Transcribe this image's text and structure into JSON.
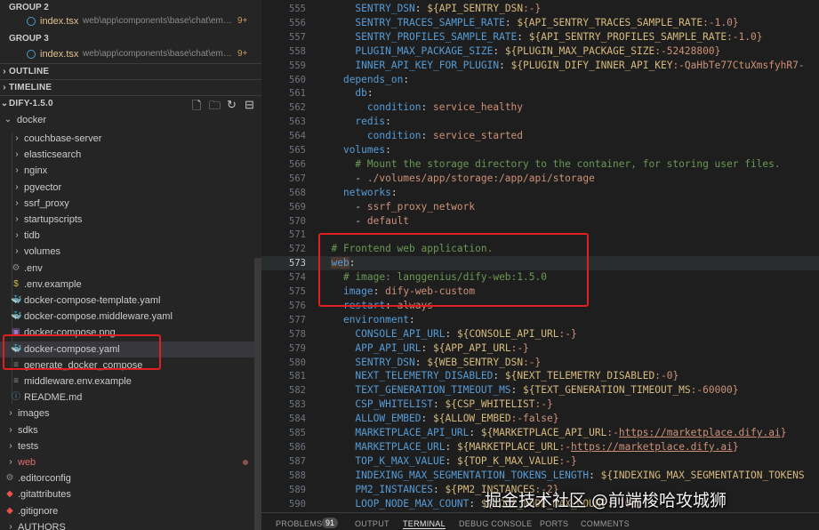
{
  "open_editors": {
    "groups": [
      {
        "label": "GROUP 2",
        "file": "index.tsx",
        "path": "web\\app\\components\\base\\chat\\emb...",
        "badge": "9+"
      },
      {
        "label": "GROUP 3",
        "file": "index.tsx",
        "path": "web\\app\\components\\base\\chat\\emb...",
        "badge": "9+"
      }
    ]
  },
  "sections": {
    "outline": "OUTLINE",
    "timeline": "TIMELINE",
    "project": "DIFY-1.5.0"
  },
  "explorer": {
    "docker_folder": "docker",
    "docker_children": [
      {
        "type": "folder",
        "name": "couchbase-server"
      },
      {
        "type": "folder",
        "name": "elasticsearch"
      },
      {
        "type": "folder",
        "name": "nginx"
      },
      {
        "type": "folder",
        "name": "pgvector"
      },
      {
        "type": "folder",
        "name": "ssrf_proxy"
      },
      {
        "type": "folder",
        "name": "startupscripts"
      },
      {
        "type": "folder",
        "name": "tidb"
      },
      {
        "type": "folder",
        "name": "volumes"
      },
      {
        "type": "file",
        "name": ".env",
        "icon": "gear-icon"
      },
      {
        "type": "file",
        "name": ".env.example",
        "icon": "dollar-icon"
      },
      {
        "type": "file",
        "name": "docker-compose-template.yaml",
        "icon": "docker-icon"
      },
      {
        "type": "file",
        "name": "docker-compose.middleware.yaml",
        "icon": "docker-icon"
      },
      {
        "type": "file",
        "name": "docker-compose.png",
        "icon": "image-icon"
      },
      {
        "type": "file",
        "name": "docker-compose.yaml",
        "icon": "docker-icon"
      },
      {
        "type": "file",
        "name": "generate_docker_compose",
        "icon": "file-icon"
      },
      {
        "type": "file",
        "name": "middleware.env.example",
        "icon": "file-icon"
      },
      {
        "type": "file",
        "name": "README.md",
        "icon": "info-icon"
      }
    ],
    "root_items": [
      {
        "type": "folder",
        "name": "images"
      },
      {
        "type": "folder",
        "name": "sdks"
      },
      {
        "type": "folder",
        "name": "tests"
      },
      {
        "type": "folder",
        "name": "web"
      },
      {
        "type": "file",
        "name": ".editorconfig",
        "icon": "gear-icon"
      },
      {
        "type": "file",
        "name": ".gitattributes",
        "icon": "git-icon"
      },
      {
        "type": "file",
        "name": ".gitignore",
        "icon": "git-icon"
      },
      {
        "type": "folder",
        "name": "AUTHORS"
      }
    ]
  },
  "editor": {
    "active_line": "573",
    "lines": [
      {
        "n": "555",
        "t": "      SENTRY_DSN: ${API_SENTRY_DSN:-}"
      },
      {
        "n": "556",
        "t": "      SENTRY_TRACES_SAMPLE_RATE: ${API_SENTRY_TRACES_SAMPLE_RATE:-1.0}"
      },
      {
        "n": "557",
        "t": "      SENTRY_PROFILES_SAMPLE_RATE: ${API_SENTRY_PROFILES_SAMPLE_RATE:-1.0}"
      },
      {
        "n": "558",
        "t": "      PLUGIN_MAX_PACKAGE_SIZE: ${PLUGIN_MAX_PACKAGE_SIZE:-52428800}"
      },
      {
        "n": "559",
        "t": "      INNER_API_KEY_FOR_PLUGIN: ${PLUGIN_DIFY_INNER_API_KEY:-QaHbTe77CtuXmsfyhR7-"
      },
      {
        "n": "560",
        "t": "    depends_on:"
      },
      {
        "n": "561",
        "t": "      db:"
      },
      {
        "n": "562",
        "t": "        condition: service_healthy"
      },
      {
        "n": "563",
        "t": "      redis:"
      },
      {
        "n": "564",
        "t": "        condition: service_started"
      },
      {
        "n": "565",
        "t": "    volumes:"
      },
      {
        "n": "566",
        "t": "      # Mount the storage directory to the container, for storing user files."
      },
      {
        "n": "567",
        "t": "      - ./volumes/app/storage:/app/api/storage"
      },
      {
        "n": "568",
        "t": "    networks:"
      },
      {
        "n": "569",
        "t": "      - ssrf_proxy_network"
      },
      {
        "n": "570",
        "t": "      - default"
      },
      {
        "n": "571",
        "t": ""
      },
      {
        "n": "572",
        "t": "  # Frontend web application."
      },
      {
        "n": "573",
        "t": "  web:"
      },
      {
        "n": "574",
        "t": "    # image: langgenius/dify-web:1.5.0"
      },
      {
        "n": "575",
        "t": "    image: dify-web-custom"
      },
      {
        "n": "576",
        "t": "    restart: always"
      },
      {
        "n": "577",
        "t": "    environment:"
      },
      {
        "n": "578",
        "t": "      CONSOLE_API_URL: ${CONSOLE_API_URL:-}"
      },
      {
        "n": "579",
        "t": "      APP_API_URL: ${APP_API_URL:-}"
      },
      {
        "n": "580",
        "t": "      SENTRY_DSN: ${WEB_SENTRY_DSN:-}"
      },
      {
        "n": "581",
        "t": "      NEXT_TELEMETRY_DISABLED: ${NEXT_TELEMETRY_DISABLED:-0}"
      },
      {
        "n": "582",
        "t": "      TEXT_GENERATION_TIMEOUT_MS: ${TEXT_GENERATION_TIMEOUT_MS:-60000}"
      },
      {
        "n": "583",
        "t": "      CSP_WHITELIST: ${CSP_WHITELIST:-}"
      },
      {
        "n": "584",
        "t": "      ALLOW_EMBED: ${ALLOW_EMBED:-false}"
      },
      {
        "n": "585",
        "t": "      MARKETPLACE_API_URL: ${MARKETPLACE_API_URL:-https://marketplace.dify.ai}"
      },
      {
        "n": "586",
        "t": "      MARKETPLACE_URL: ${MARKETPLACE_URL:-https://marketplace.dify.ai}"
      },
      {
        "n": "587",
        "t": "      TOP_K_MAX_VALUE: ${TOP_K_MAX_VALUE:-}"
      },
      {
        "n": "588",
        "t": "      INDEXING_MAX_SEGMENTATION_TOKENS_LENGTH: ${INDEXING_MAX_SEGMENTATION_TOKENS"
      },
      {
        "n": "589",
        "t": "      PM2_INSTANCES: ${PM2_INSTANCES:-2}"
      },
      {
        "n": "590",
        "t": "      LOOP_NODE_MAX_COUNT: ${LOOP_NODE_MAX_COUNT:-100}"
      }
    ]
  },
  "panel_tabs": [
    {
      "label": "PROBLEMS",
      "badge": "91"
    },
    {
      "label": "OUTPUT"
    },
    {
      "label": "TERMINAL",
      "active": true
    },
    {
      "label": "DEBUG CONSOLE"
    },
    {
      "label": "PORTS"
    },
    {
      "label": "COMMENTS"
    }
  ],
  "watermark": "掘金技术社区 @前端梭哈攻城狮",
  "colors": {
    "annotation": "#e02020",
    "accent": "#569cd6"
  }
}
